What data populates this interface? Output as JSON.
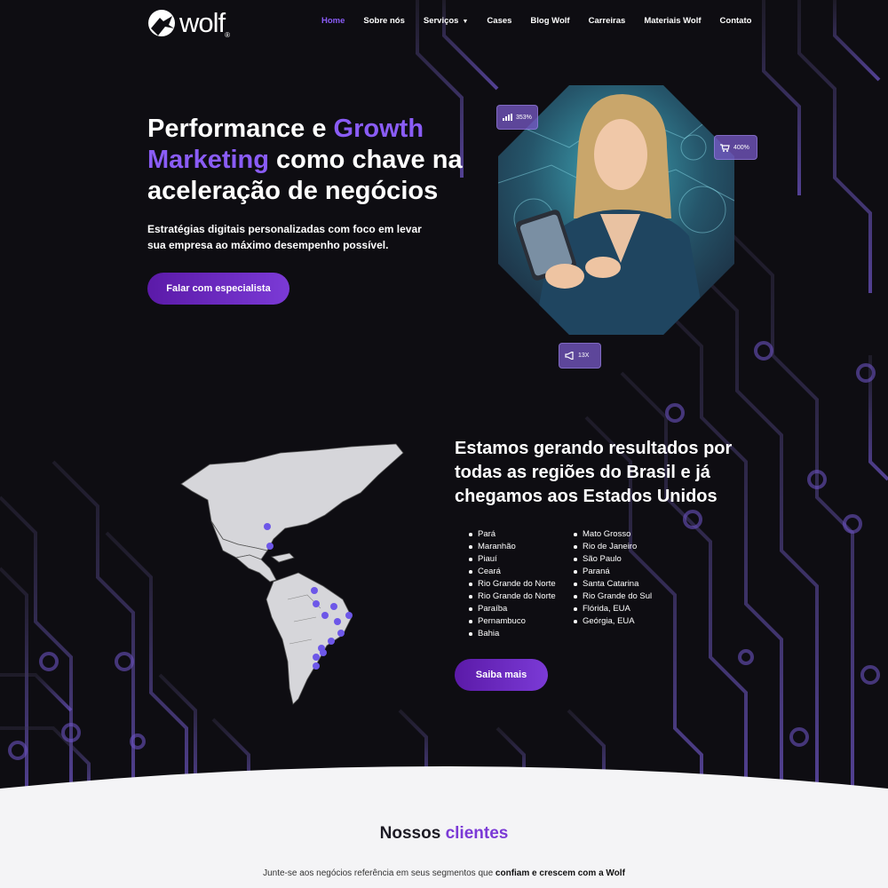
{
  "brand": {
    "name": "wolf",
    "reg": "®"
  },
  "nav": {
    "items": [
      {
        "label": "Home",
        "active": true
      },
      {
        "label": "Sobre nós"
      },
      {
        "label": "Serviços",
        "dropdown": true
      },
      {
        "label": "Cases"
      },
      {
        "label": "Blog Wolf"
      },
      {
        "label": "Carreiras"
      },
      {
        "label": "Materiais Wolf"
      },
      {
        "label": "Contato"
      }
    ]
  },
  "hero": {
    "title_a": "Performance e ",
    "title_b": "Growth Marketing",
    "title_c": " como chave na aceleração de negócios",
    "subtitle": "Estratégias digitais personalizadas com foco em levar sua empresa ao máximo desempenho possível.",
    "cta": "Falar com especialista",
    "badges": [
      {
        "icon": "bar-chart-icon",
        "value": "353%"
      },
      {
        "icon": "shopping-cart-icon",
        "value": "400%"
      },
      {
        "icon": "megaphone-icon",
        "value": "13X"
      }
    ]
  },
  "results": {
    "title": "Estamos gerando resultados por todas as regiões do Brasil e já chegamos aos Estados Unidos",
    "col_a": [
      "Pará",
      "Maranhão",
      "Piauí",
      "Ceará",
      "Rio Grande do Norte",
      "Rio Grande do Norte",
      "Paraíba",
      "Pernambuco",
      "Bahia"
    ],
    "col_b": [
      "Mato Grosso",
      "Rio de Janeiro",
      "São Paulo",
      "Paraná",
      "Santa Catarina",
      "Rio Grande do Sul",
      "Flórida, EUA",
      "Geórgia, EUA"
    ],
    "cta": "Saiba mais"
  },
  "clients": {
    "title_a": "Nossos ",
    "title_b": "clientes",
    "subtitle_a": "Junte-se aos negócios referência em seus segmentos que ",
    "subtitle_b": "confiam e crescem com a Wolf"
  },
  "colors": {
    "accent": "#8a5cf6",
    "bg": "#0e0d12",
    "button": "#6a2ac4",
    "light": "#f4f4f6"
  }
}
